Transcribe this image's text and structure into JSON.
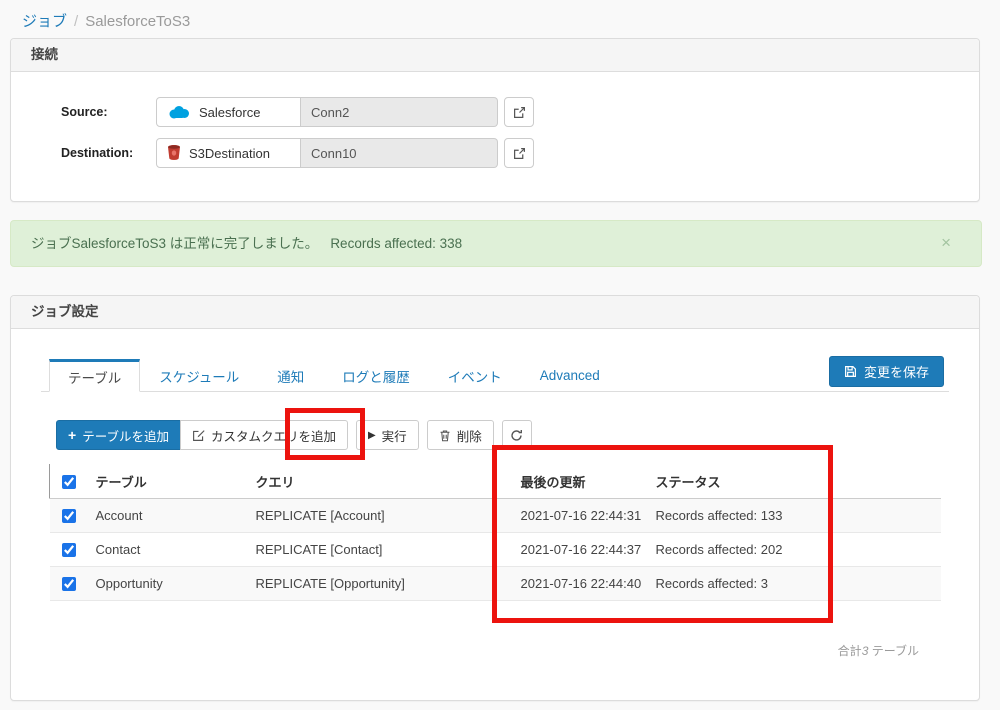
{
  "breadcrumb": {
    "parent": "ジョブ",
    "separator": "/",
    "current": "SalesforceToS3"
  },
  "connection_panel": {
    "title": "接続",
    "rows": [
      {
        "label": "Source:",
        "connector": "Salesforce",
        "connection": "Conn2"
      },
      {
        "label": "Destination:",
        "connector": "S3Destination",
        "connection": "Conn10"
      }
    ]
  },
  "alert": {
    "message": "ジョブSalesforceToS3 は正常に完了しました。",
    "detail": "Records affected: 338",
    "close_label": "×"
  },
  "job_panel": {
    "title": "ジョブ設定",
    "tabs": [
      {
        "label": "テーブル",
        "active": true
      },
      {
        "label": "スケジュール",
        "active": false
      },
      {
        "label": "通知",
        "active": false
      },
      {
        "label": "ログと履歴",
        "active": false
      },
      {
        "label": "イベント",
        "active": false
      },
      {
        "label": "Advanced",
        "active": false
      }
    ],
    "save_button": "変更を保存",
    "toolbar": {
      "add_table": "テーブルを追加",
      "add_custom_query": "カスタムクエリを追加",
      "run": "実行",
      "delete": "削除"
    },
    "table": {
      "headers": {
        "table": "テーブル",
        "query": "クエリ",
        "last_update": "最後の更新",
        "status": "ステータス"
      },
      "select_all_checked": true,
      "rows": [
        {
          "checked": true,
          "table": "Account",
          "query": "REPLICATE [Account]",
          "last_update": "2021-07-16 22:44:31",
          "status": "Records affected: 133"
        },
        {
          "checked": true,
          "table": "Contact",
          "query": "REPLICATE [Contact]",
          "last_update": "2021-07-16 22:44:37",
          "status": "Records affected: 202"
        },
        {
          "checked": true,
          "table": "Opportunity",
          "query": "REPLICATE [Opportunity]",
          "last_update": "2021-07-16 22:44:40",
          "status": "Records affected: 3"
        }
      ],
      "footer": {
        "prefix": "合計",
        "count": "3",
        "suffix": " テーブル"
      }
    }
  },
  "colors": {
    "accent_blue": "#1e7bb8",
    "alert_bg": "#dff0d8",
    "alert_text": "#4a7050",
    "annotation_red": "#ec130e",
    "salesforce_blue": "#00a1e0",
    "s3_red": "#c13c31"
  }
}
